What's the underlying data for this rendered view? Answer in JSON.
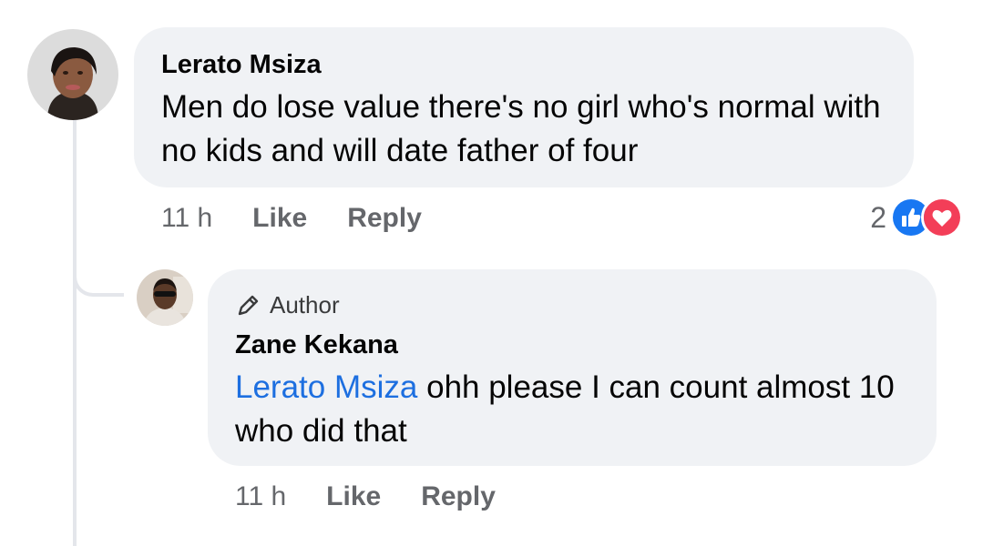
{
  "comment": {
    "author": "Lerato Msiza",
    "text": "Men do lose value there's no girl who's normal with no kids and will date father of four",
    "time": "11 h",
    "like_label": "Like",
    "reply_label": "Reply",
    "reaction_count": "2",
    "reactions": [
      "like-icon",
      "heart-icon"
    ]
  },
  "reply": {
    "badge": "Author",
    "badge_icon": "pencil-icon",
    "author": "Zane Kekana",
    "mention": "Lerato Msiza",
    "text": " ohh please I can count almost 10 who did that",
    "time": "11 h",
    "like_label": "Like",
    "reply_label": "Reply"
  },
  "colors": {
    "bubble_bg": "#f0f2f5",
    "mention": "#1d6fe0",
    "meta_text": "#65676b",
    "like_blue": "#1877f2",
    "heart_red": "#f33e58",
    "thread_line": "#e4e6eb"
  }
}
